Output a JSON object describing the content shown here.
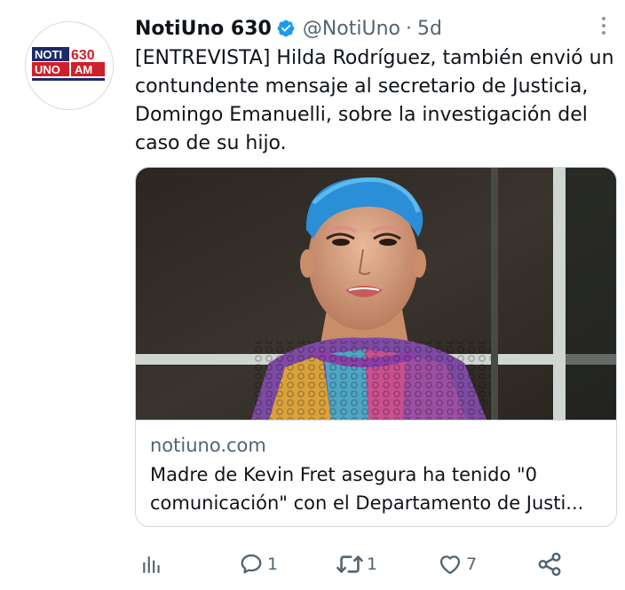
{
  "tweet": {
    "author_name": "NotiUno 630",
    "handle": "@NotiUno",
    "separator": "·",
    "time": "5d",
    "avatar_logo_text": "NOTI UNO 630 AM",
    "text_lines": [
      "[ENTREVISTA] Hilda Rodríguez, también envió un",
      "contundente mensaje al secretario de Justicia,",
      "Domingo Emanuelli, sobre la investigación del",
      "caso de su hijo."
    ]
  },
  "card": {
    "domain": "notiuno.com",
    "title_lines": [
      "Madre de Kevin Fret asegura ha tenido \"0",
      "comunicación\" con el Departamento de Justi..."
    ]
  },
  "actions": {
    "analytics_icon": "bar-chart-icon",
    "reply_icon": "speech-bubble-icon",
    "reply_count": "1",
    "retweet_icon": "retweet-icon",
    "retweet_count": "1",
    "like_icon": "heart-icon",
    "like_count": "7",
    "share_icon": "share-icon"
  },
  "colors": {
    "text_primary": "#0f1419",
    "text_secondary": "#536471",
    "verified_blue": "#1d9bf0",
    "border": "#cfd9de",
    "logo_red": "#d11f2a",
    "logo_navy": "#1c2a6b"
  }
}
